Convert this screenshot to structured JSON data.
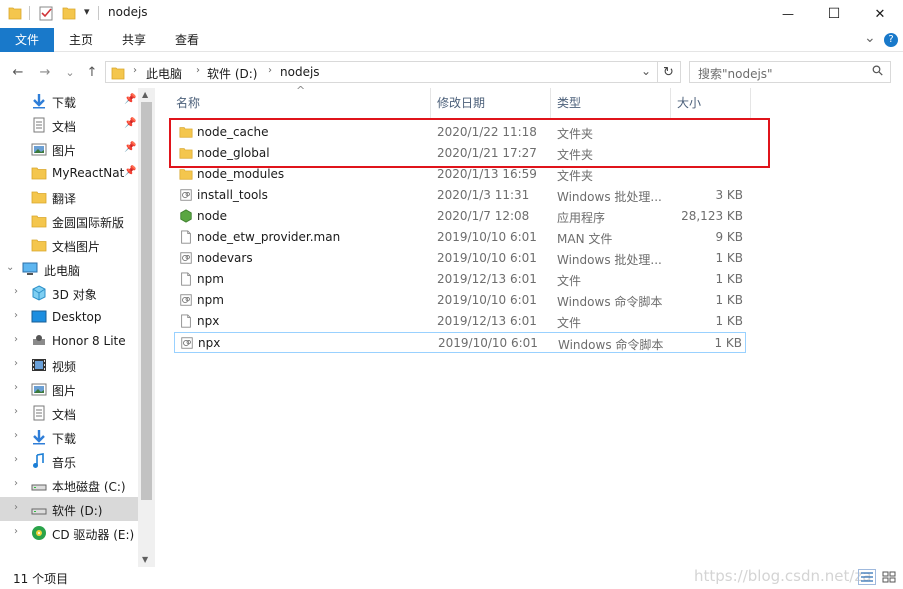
{
  "window": {
    "title": "nodejs",
    "minimize_glyph": "—",
    "maximize_glyph": "☐",
    "close_glyph": "✕"
  },
  "ribbon": {
    "tabs": [
      {
        "label": "文件"
      },
      {
        "label": "主页"
      },
      {
        "label": "共享"
      },
      {
        "label": "查看"
      }
    ],
    "collapse_glyph": "⌄",
    "help_glyph": "?"
  },
  "nav": {
    "back_glyph": "←",
    "forward_glyph": "→",
    "recent_glyph": "⌄",
    "up_glyph": "↑",
    "dropdown_glyph": "⌄",
    "refresh_glyph": "↻",
    "breadcrumb": [
      "此电脑",
      "软件 (D:)",
      "nodejs"
    ],
    "crumb_sep": "›"
  },
  "search": {
    "placeholder": "搜索\"nodejs\"",
    "icon_glyph": "⚲"
  },
  "sidebar": {
    "quick_access": [
      {
        "label": "下载",
        "icon": "download-icon",
        "pinned": true
      },
      {
        "label": "文档",
        "icon": "documents-icon",
        "pinned": true
      },
      {
        "label": "图片",
        "icon": "pictures-icon",
        "pinned": true
      },
      {
        "label": "MyReactNat",
        "icon": "folder-icon",
        "pinned": true
      },
      {
        "label": "翻译",
        "icon": "folder-icon",
        "pinned": false
      },
      {
        "label": "金圆国际新版",
        "icon": "folder-icon",
        "pinned": false
      },
      {
        "label": "文档图片",
        "icon": "folder-icon",
        "pinned": false
      }
    ],
    "this_pc": {
      "label": "此电脑",
      "icon": "this-pc-icon"
    },
    "pc_items": [
      {
        "label": "3D 对象",
        "icon": "3d-objects-icon"
      },
      {
        "label": "Desktop",
        "icon": "desktop-icon"
      },
      {
        "label": "Honor 8 Lite",
        "icon": "phone-icon"
      },
      {
        "label": "视频",
        "icon": "videos-icon"
      },
      {
        "label": "图片",
        "icon": "pictures-icon"
      },
      {
        "label": "文档",
        "icon": "documents-icon"
      },
      {
        "label": "下载",
        "icon": "download-icon"
      },
      {
        "label": "音乐",
        "icon": "music-icon"
      },
      {
        "label": "本地磁盘 (C:)",
        "icon": "drive-icon"
      },
      {
        "label": "软件 (D:)",
        "icon": "drive-icon",
        "selected": true
      },
      {
        "label": "CD 驱动器 (E:) I",
        "icon": "cd-drive-icon"
      }
    ],
    "pin_glyph": "📌",
    "expand_glyph": "›",
    "expanded_glyph": "⌄"
  },
  "columns": {
    "name": "名称",
    "date": "修改日期",
    "type": "类型",
    "size": "大小",
    "sort_glyph": "^"
  },
  "files": [
    {
      "name": "node_cache",
      "date": "2020/1/22 11:18",
      "type": "文件夹",
      "size": "",
      "icon": "folder-icon"
    },
    {
      "name": "node_global",
      "date": "2020/1/21 17:27",
      "type": "文件夹",
      "size": "",
      "icon": "folder-icon"
    },
    {
      "name": "node_modules",
      "date": "2020/1/13 16:59",
      "type": "文件夹",
      "size": "",
      "icon": "folder-icon"
    },
    {
      "name": "install_tools",
      "date": "2020/1/3 11:31",
      "type": "Windows 批处理...",
      "size": "3 KB",
      "icon": "batch-file-icon"
    },
    {
      "name": "node",
      "date": "2020/1/7 12:08",
      "type": "应用程序",
      "size": "28,123 KB",
      "icon": "nodejs-app-icon"
    },
    {
      "name": "node_etw_provider.man",
      "date": "2019/10/10 6:01",
      "type": "MAN 文件",
      "size": "9 KB",
      "icon": "blank-file-icon"
    },
    {
      "name": "nodevars",
      "date": "2019/10/10 6:01",
      "type": "Windows 批处理...",
      "size": "1 KB",
      "icon": "batch-file-icon"
    },
    {
      "name": "npm",
      "date": "2019/12/13 6:01",
      "type": "文件",
      "size": "1 KB",
      "icon": "blank-file-icon"
    },
    {
      "name": "npm",
      "date": "2019/10/10 6:01",
      "type": "Windows 命令脚本",
      "size": "1 KB",
      "icon": "cmd-script-icon"
    },
    {
      "name": "npx",
      "date": "2019/12/13 6:01",
      "type": "文件",
      "size": "1 KB",
      "icon": "blank-file-icon"
    },
    {
      "name": "npx",
      "date": "2019/10/10 6:01",
      "type": "Windows 命令脚本",
      "size": "1 KB",
      "icon": "cmd-script-icon",
      "focused": true
    }
  ],
  "status": {
    "item_count": "11 个项目",
    "watermark": "https://blog.csdn.net/za"
  },
  "colors": {
    "accent": "#1979ca",
    "highlight_border": "#e0141b",
    "folder": "#f4c64d",
    "selected_bg": "#d9d9d9",
    "focus_border": "#99d1ff"
  }
}
